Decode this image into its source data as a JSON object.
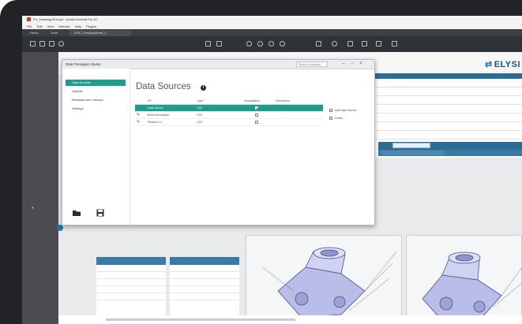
{
  "window": {
    "title": "Fix_DrawingsTest.pdf - Adobe Acrobat Pro DC",
    "menu": [
      "File",
      "Edit",
      "View",
      "Window",
      "Help",
      "Plugins"
    ],
    "tabs": [
      "Home",
      "Tools",
      "DOC_DrawingSheet_1"
    ]
  },
  "logo": {
    "text": "ELYSI"
  },
  "dialog": {
    "title": "Data Packages Studio",
    "search_placeholder": "Search templates...",
    "controls": {
      "minimize": "–",
      "maximize": "▫",
      "close": "×"
    },
    "nav": [
      {
        "label": "Data Sources",
        "active": true
      },
      {
        "label": "Objects",
        "active": false
      },
      {
        "label": "Metadata and Librarys",
        "active": false
      },
      {
        "label": "Settings",
        "active": false
      }
    ],
    "nav_footer_icons": [
      "folder-open-icon",
      "save-icon"
    ],
    "heading": "Data Sources",
    "info_icon": "info-icon",
    "table": {
      "columns": [
        "ID*",
        "Type*",
        "Visualization",
        "Description"
      ],
      "rows": [
        {
          "edit_icon": "",
          "id": "Data Source",
          "type": "CSV",
          "visualization": true,
          "description": "",
          "selected": true
        },
        {
          "edit_icon": "✎",
          "id": "BOM Information",
          "type": "CSV",
          "visualization": false,
          "description": "",
          "selected": false
        },
        {
          "edit_icon": "✎",
          "id": "Revision Lt",
          "type": "CSV",
          "visualization": false,
          "description": "",
          "selected": false
        }
      ]
    },
    "side_actions": [
      {
        "label": "Add Data Source",
        "icon": "add-icon"
      },
      {
        "label": "Delete",
        "icon": "delete-icon"
      }
    ]
  },
  "colors": {
    "accent": "#1b9e8f",
    "header_blue": "#2d6c94",
    "dark_bezel": "#222326"
  }
}
